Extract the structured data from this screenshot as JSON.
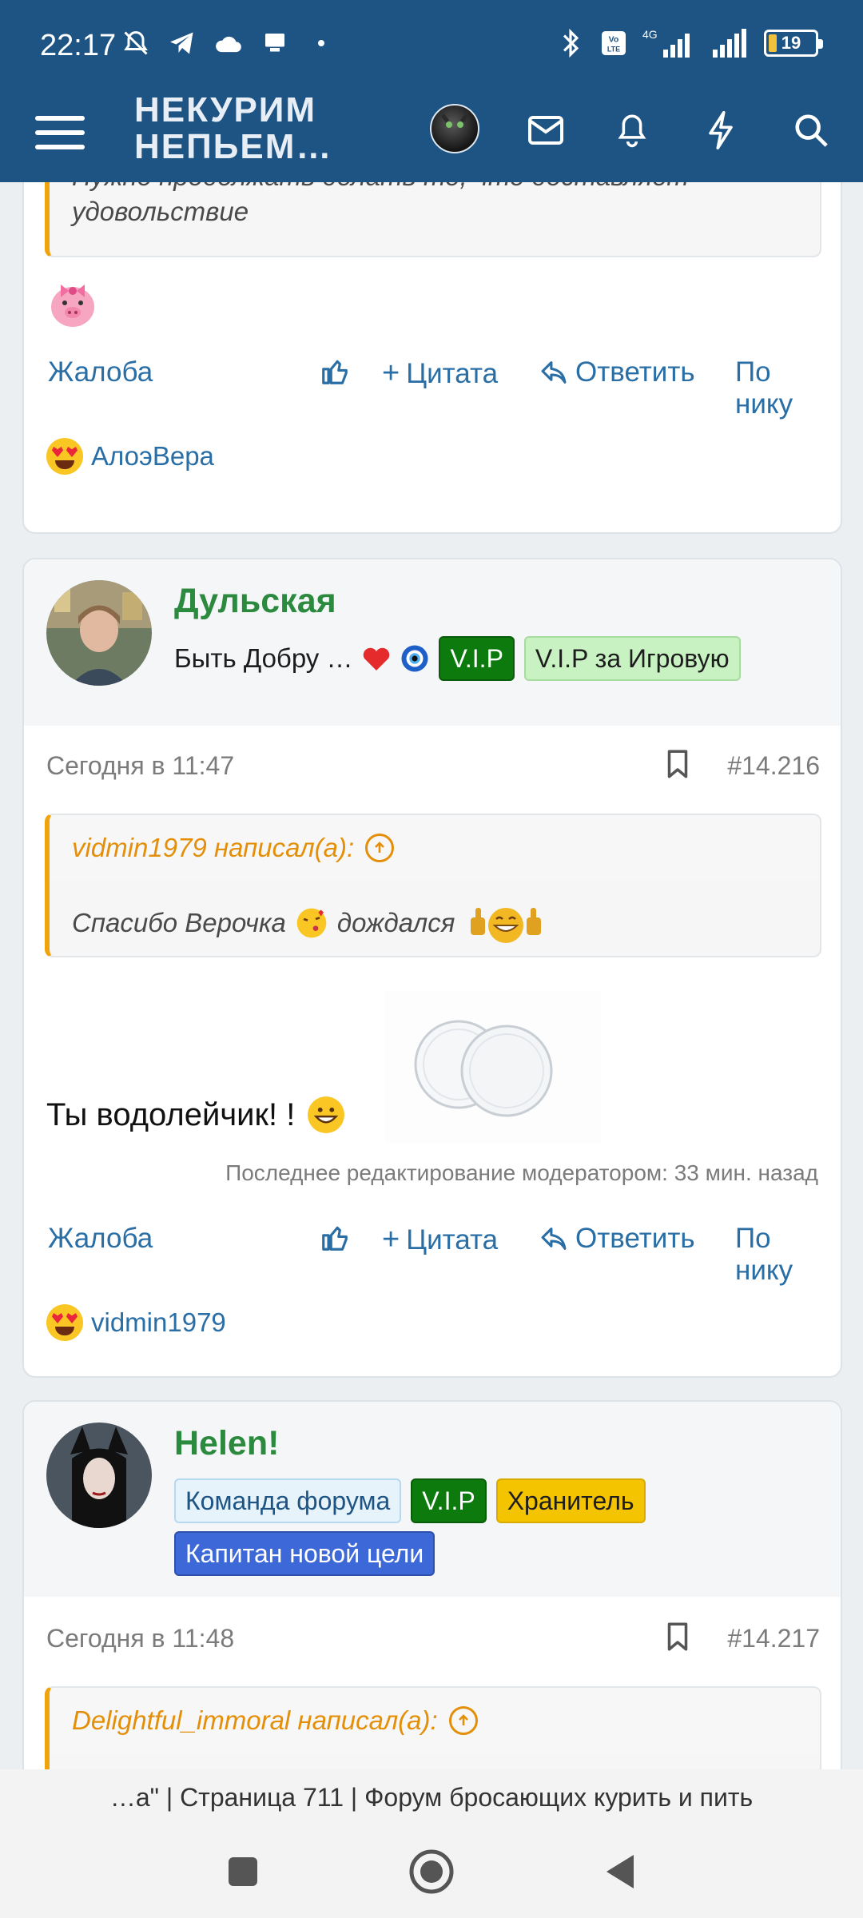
{
  "status_bar": {
    "time": "22:17",
    "battery": "19",
    "network": "4G"
  },
  "header": {
    "logo_line1": "НЕКУРИМ",
    "logo_line2": "НЕПЬЕМ…",
    "icons": [
      "menu-icon",
      "avatar",
      "mail-icon",
      "bell-icon",
      "lightning-icon",
      "search-icon"
    ]
  },
  "post_prev": {
    "quote_text_line1": "Нужно продолжать делать то, что доставляет",
    "quote_text_line2": "удовольствие",
    "actions": {
      "report": "Жалоба",
      "quote": "Цитата",
      "reply": "Ответить",
      "by_nick": "По нику"
    },
    "reaction_user": "АлоэВера"
  },
  "post_1": {
    "username": "Дульская",
    "user_title": "Быть Добру …",
    "badges": [
      "V.I.P",
      "V.I.P за Игровую"
    ],
    "date": "Сегодня в 11:47",
    "number": "#14.216",
    "quote_author": "vidmin1979 написал(а):",
    "quote_text_a": "Спасибо Верочка",
    "quote_text_b": "дождался",
    "text": "Ты водолейчик! !",
    "edited": "Последнее редактирование модератором: 33 мин. назад",
    "actions": {
      "report": "Жалоба",
      "quote": "Цитата",
      "reply": "Ответить",
      "by_nick": "По нику"
    },
    "reaction_user": "vidmin1979"
  },
  "post_2": {
    "username": "Helen!",
    "badges": [
      "Команда форума",
      "V.I.P",
      "Хранитель",
      "Капитан новой цели"
    ],
    "date": "Сегодня в 11:48",
    "number": "#14.217",
    "quote_author": "Delightful_immoral написал(а):"
  },
  "url_bar": {
    "text": "…а\" | Страница 711 | Форум бросающих курить и пить"
  },
  "colors": {
    "brand": "#1e5484",
    "username": "#2c8a3e",
    "link": "#2a6ea6",
    "quote_accent": "#f0a30a"
  }
}
